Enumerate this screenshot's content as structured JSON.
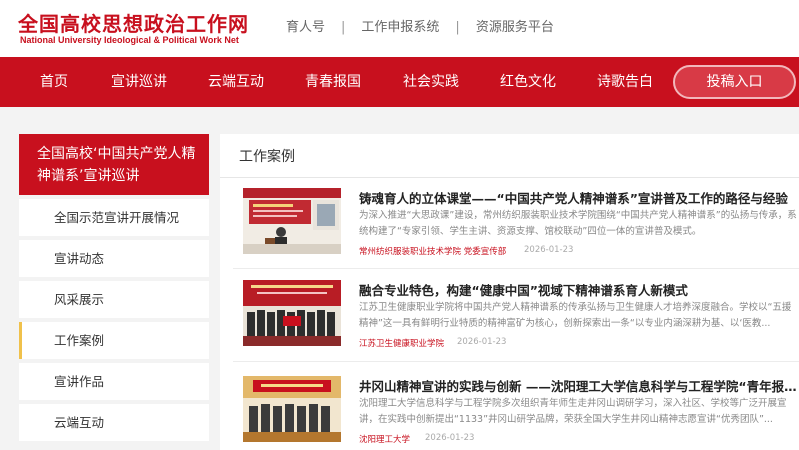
{
  "header": {
    "logo_cn": "全国高校思想政治工作网",
    "logo_en": "National University Ideological & Political Work Net",
    "links": [
      "育人号",
      "工作申报系统",
      "资源服务平台"
    ],
    "separator": "|"
  },
  "nav": {
    "items": [
      "首页",
      "宣讲巡讲",
      "云端互动",
      "青春报国",
      "社会实践",
      "红色文化",
      "诗歌告白"
    ],
    "submit_label": "投稿入口"
  },
  "sidebar": {
    "heading": "全国高校‘中国共产党人精神谱系’宣讲巡讲",
    "items": [
      "全国示范宣讲开展情况",
      "宣讲动态",
      "风采展示",
      "工作案例",
      "宣讲作品",
      "云端互动"
    ],
    "active_index": 3
  },
  "main": {
    "title": "工作案例",
    "articles": [
      {
        "title": "铸魂育人的立体课堂——“中国共产党人精神谱系”宣讲普及工作的路径与经验",
        "summary": "为深入推进“大思政课”建设，常州纺织服装职业技术学院围绕“中国共产党人精神谱系”的弘扬与传承，系统构建了“专家引领、学生主讲、资源支撑、馆校联动”四位一体的宣讲普及模式。",
        "source": "常州纺织服装职业技术学院 党委宣传部",
        "date": "2026-01-23"
      },
      {
        "title": "融合专业特色，构建“健康中国”视域下精神谱系育人新模式",
        "summary": "江苏卫生健康职业学院将中国共产党人精神谱系的传承弘扬与卫生健康人才培养深度融合。学校以“五援精神”这一具有鲜明行业特质的精神富矿为核心，创新探索出一条“以专业内涵深耕为基、以‘医教...",
        "source": "江苏卫生健康职业学院",
        "date": "2026-01-23"
      },
      {
        "title": "井冈山精神宣讲的实践与创新 ——沈阳理工大学信息科学与工程学院“青年报国...",
        "summary": "沈阳理工大学信息科学与工程学院多次组织青年师生走井冈山调研学习，深入社区、学校等广泛开展宣讲，在实践中创新提出“1133”井冈山研学品牌，荣获全国大学生井冈山精神志愿宣讲“优秀团队”...",
        "source": "沈阳理工大学",
        "date": "2026-01-23"
      }
    ]
  }
}
